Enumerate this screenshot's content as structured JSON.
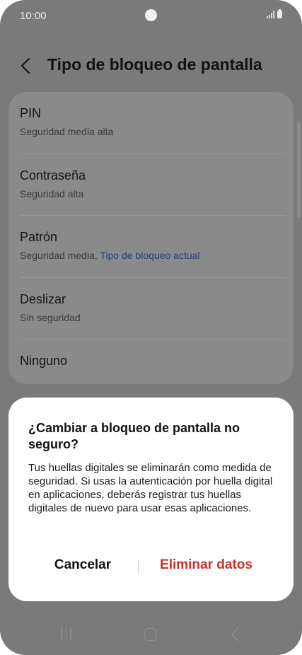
{
  "status_bar": {
    "time": "10:00"
  },
  "header": {
    "title": "Tipo de bloqueo de pantalla"
  },
  "options": [
    {
      "title": "PIN",
      "subtitle": "Seguridad media alta",
      "current_label": ""
    },
    {
      "title": "Contraseña",
      "subtitle": "Seguridad alta",
      "current_label": ""
    },
    {
      "title": "Patrón",
      "subtitle": "Seguridad media, ",
      "current_label": "Tipo de bloqueo actual"
    },
    {
      "title": "Deslizar",
      "subtitle": "Sin seguridad",
      "current_label": ""
    },
    {
      "title": "Ninguno",
      "subtitle": "",
      "current_label": ""
    }
  ],
  "dialog": {
    "title": "¿Cambiar a bloqueo de pantalla no seguro?",
    "body": "Tus huellas digitales se eliminarán como medida de seguridad. Si usas la autenticación por huella digital en aplicaciones, deberás registrar tus huellas digitales de nuevo para usar esas aplicaciones.",
    "cancel_label": "Cancelar",
    "confirm_label": "Eliminar datos"
  },
  "colors": {
    "dim_background": "#7a7a7a",
    "accent_link": "#243d7c",
    "destructive": "#c8302b",
    "dialog_background": "#ffffff"
  },
  "icons": {
    "back": "chevron-left-icon",
    "nav_recent": "recent-apps-icon",
    "nav_home": "home-icon",
    "nav_back": "back-arrow-icon",
    "signal": "signal-icon",
    "battery": "battery-icon"
  }
}
